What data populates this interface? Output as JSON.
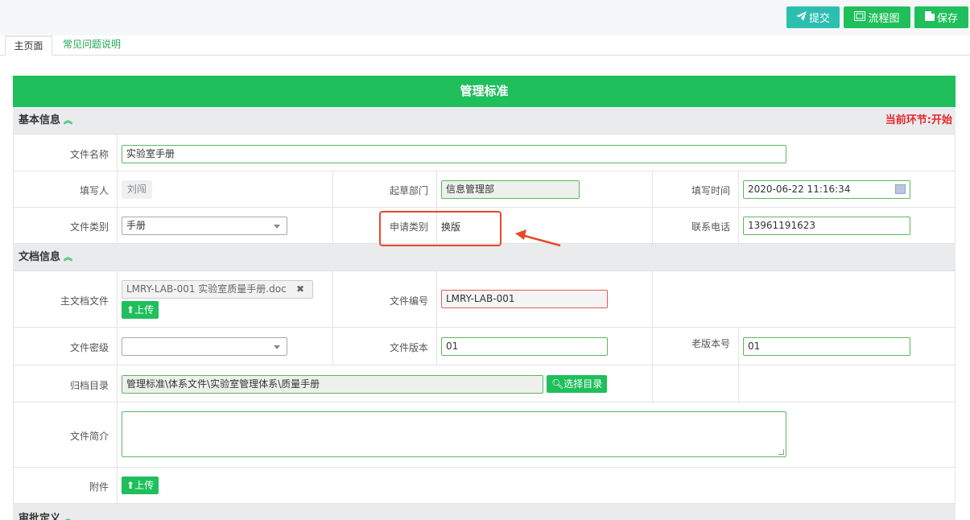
{
  "toolbar": {
    "submit_label": "提交",
    "flow_label": "流程图",
    "save_label": "保存"
  },
  "tabs": [
    {
      "label": "主页面"
    },
    {
      "label": "常见问题说明"
    }
  ],
  "form_title": "管理标准",
  "basic": {
    "title": "基本信息",
    "status": "当前环节:开始",
    "file_name_label": "文件名称",
    "file_name_value": "实验室手册",
    "writer_label": "填写人",
    "writer_value": "刘闯",
    "dept_label": "起草部门",
    "dept_value": "信息管理部",
    "time_label": "填写时间",
    "time_value": "2020-06-22 11:16:34",
    "category_label": "文件类别",
    "category_value": "手册",
    "apply_type_label": "申请类别",
    "apply_type_value": "换版",
    "phone_label": "联系电话",
    "phone_value": "13961191623"
  },
  "doc": {
    "title": "文档信息",
    "main_file_label": "主文档文件",
    "main_file_value": "LMRY-LAB-001 实验室质量手册.doc",
    "upload_label": "上传",
    "file_no_label": "文件编号",
    "file_no_value": "LMRY-LAB-001",
    "secret_label": "文件密级",
    "secret_value": "",
    "version_label": "文件版本",
    "version_value": "01",
    "old_version_label": "老版本号",
    "old_version_value": "01",
    "archive_label": "归档目录",
    "archive_value": "管理标准\\体系文件\\实验室管理体系\\质量手册",
    "choose_dir_label": "选择目录",
    "summary_label": "文件简介",
    "attach_label": "附件",
    "attach_upload_label": "上传"
  },
  "approval": {
    "title": "审批定义"
  },
  "colors": {
    "accent": "#1fbf5c",
    "teal": "#2bbfb0",
    "status_red": "#e8262a",
    "annotation": "#e84a26"
  }
}
